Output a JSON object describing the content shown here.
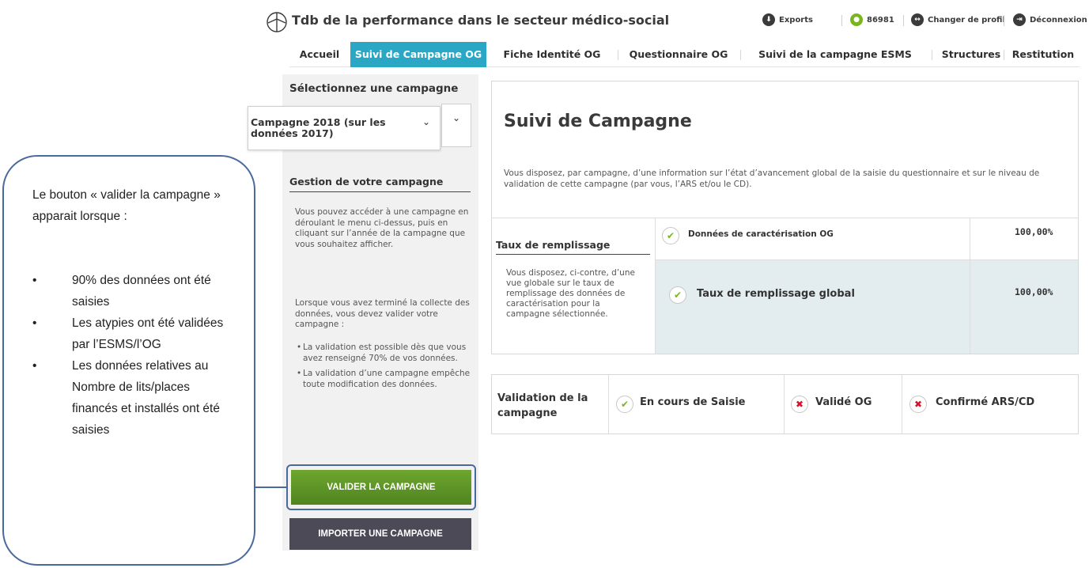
{
  "header": {
    "app_title": "Tdb de la performance dans le secteur médico-social",
    "exports_label": "Exports",
    "user_id": "86981",
    "change_profile_label": "Changer de profil",
    "logout_label": "Déconnexion"
  },
  "nav": {
    "tabs": [
      {
        "label": "Accueil"
      },
      {
        "label": "Suivi de Campagne OG",
        "active": true
      },
      {
        "label": "Fiche Identité OG"
      },
      {
        "label": "Questionnaire OG"
      },
      {
        "label": "Suivi de la campagne ESMS"
      },
      {
        "label": "Structures"
      },
      {
        "label": "Restitution"
      }
    ]
  },
  "sidebar": {
    "select_label": "Sélectionnez une campagne",
    "selected_campaign": "Campagne 2018 (sur les données 2017)",
    "management_title": "Gestion de votre campagne",
    "intro_text": "Vous pouvez accéder à une campagne en déroulant le menu ci-dessus, puis en cliquant sur l’année de la campagne que vous souhaitez afficher.",
    "validation_text": "Lorsque vous avez terminé la collecte des données, vous devez valider votre campagne :",
    "bullets": [
      "La validation est possible dès que vous avez renseigné 70% de vos données.",
      "La validation d’une campagne empêche toute modification des données."
    ],
    "validate_button": "VALIDER LA CAMPAGNE",
    "import_button": "IMPORTER UNE CAMPAGNE"
  },
  "main": {
    "title": "Suivi de Campagne",
    "description": "Vous disposez, par campagne, d’une information sur l’état d’avancement global de la saisie du questionnaire et sur le niveau de validation de cette campagne (par vous, l’ARS et/ou le CD).",
    "fill_rate_title": "Taux de remplissage",
    "fill_rate_desc": "Vous disposez, ci-contre, d’une vue globale sur le taux de remplissage des données de caractérisation pour la campagne sélectionnée.",
    "rows": [
      {
        "label": "Données de caractérisation OG",
        "value": "100,00%",
        "status": "ok"
      },
      {
        "label": "Taux de remplissage global",
        "value": "100,00%",
        "status": "ok"
      }
    ]
  },
  "validation": {
    "title": "Validation de la campagne",
    "steps": [
      {
        "label": "En cours de Saisie",
        "status": "ok"
      },
      {
        "label": "Validé OG",
        "status": "ko"
      },
      {
        "label": "Confirmé ARS/CD",
        "status": "ko"
      }
    ]
  },
  "callout": {
    "intro": "Le bouton « valider la campagne » apparait lorsque :",
    "items": [
      "90% des données ont été saisies",
      "Les atypies ont été validées par l’ESMS/l’OG",
      "Les données relatives au Nombre de lits/places financés et installés ont été saisies"
    ]
  },
  "colors": {
    "accent": "#2ba7c6",
    "ok": "#7ab51d",
    "ko": "#d6132b",
    "validate_button": "#5e9627",
    "import_button": "#4c4a57",
    "callout_border": "#4a6a9e"
  },
  "icons": {
    "logo": "plane-circle-logo",
    "exports": "download-icon",
    "user": "user-icon",
    "change_profile": "swap-profile-icon",
    "logout": "logout-icon",
    "check": "check-icon",
    "cross": "cross-icon"
  }
}
